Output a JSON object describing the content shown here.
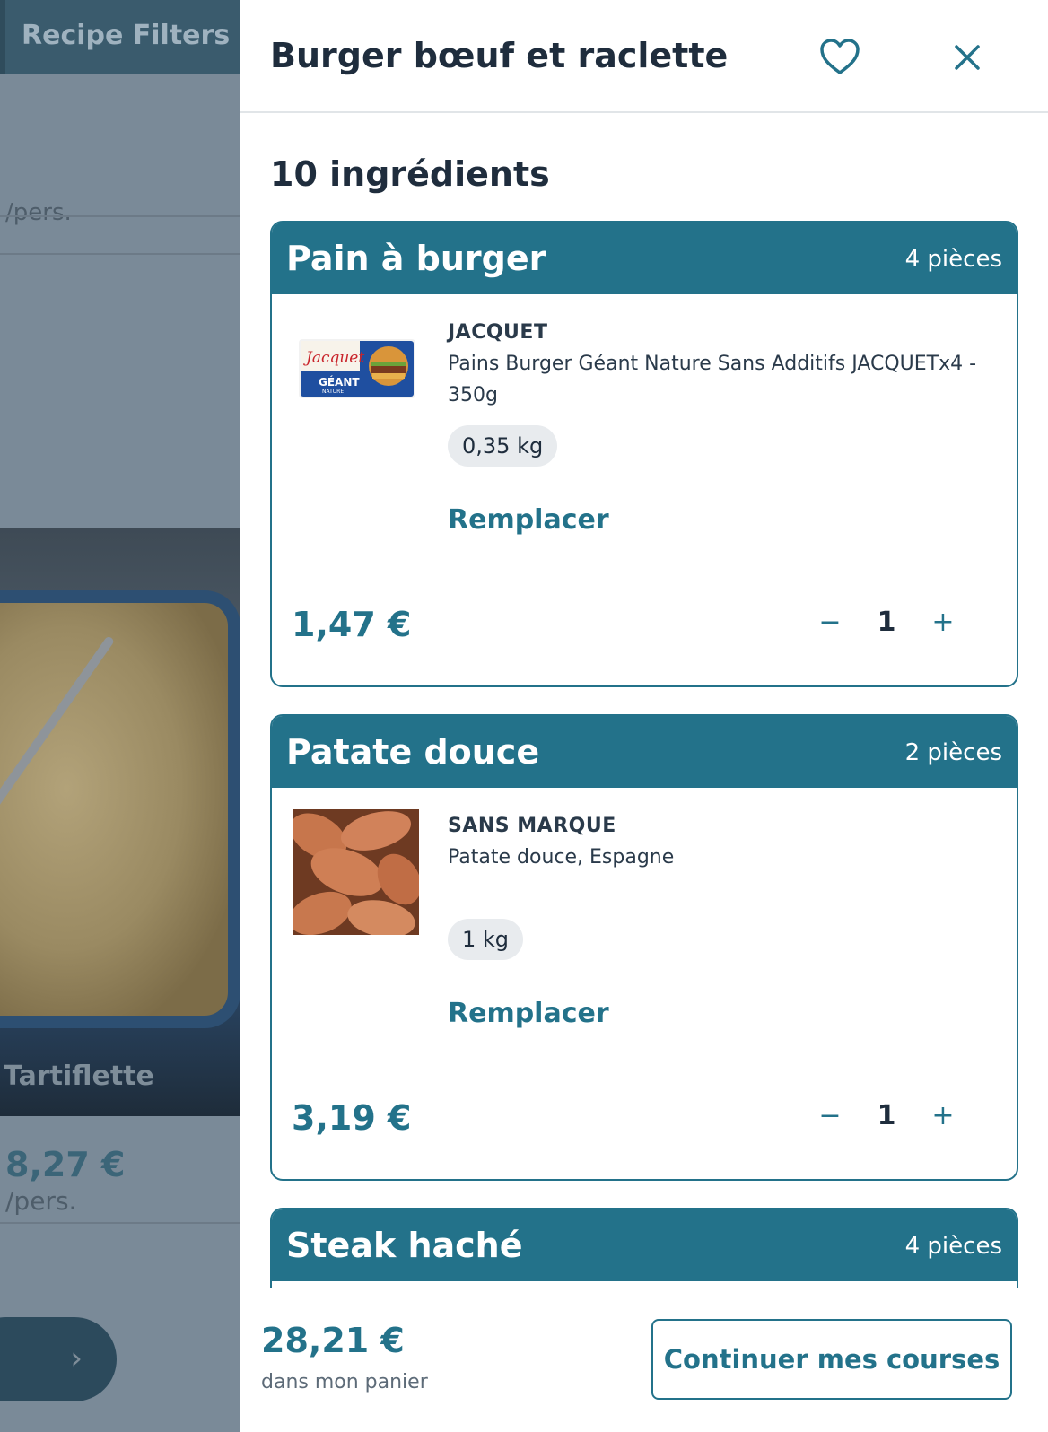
{
  "background": {
    "tab_label": "Recipe Filters",
    "pers_top": "/pers.",
    "recipe_title": "Tartiflette",
    "recipe_price": "8,27 €",
    "recipe_pers": "/pers.",
    "next_icon": "chevron-right-icon"
  },
  "panel": {
    "title": "Burger bœuf et raclette",
    "favorite_icon": "heart-outline-icon",
    "close_icon": "close-icon",
    "ingredient_count": "10 ingrédients",
    "accent_color": "#23728a"
  },
  "ingredients": [
    {
      "name": "Pain à burger",
      "quantity": "4 pièces",
      "brand": "JACQUET",
      "description": "Pains Burger Géant Nature Sans Additifs JACQUETx4 - 350g",
      "weight": "0,35 kg",
      "replace_label": "Remplacer",
      "price": "1,47 €",
      "count": "1",
      "image": "jacquet-burger-buns-package"
    },
    {
      "name": "Patate douce",
      "quantity": "2 pièces",
      "brand": "SANS MARQUE",
      "description": "Patate douce, Espagne",
      "weight": "1 kg",
      "replace_label": "Remplacer",
      "price": "3,19 €",
      "count": "1",
      "image": "sweet-potatoes-photo"
    },
    {
      "name": "Steak haché",
      "quantity": "4 pièces"
    }
  ],
  "stepper": {
    "minus": "−",
    "plus": "+"
  },
  "footer": {
    "total": "28,21 €",
    "total_label": "dans mon panier",
    "continue_label": "Continuer mes courses"
  }
}
